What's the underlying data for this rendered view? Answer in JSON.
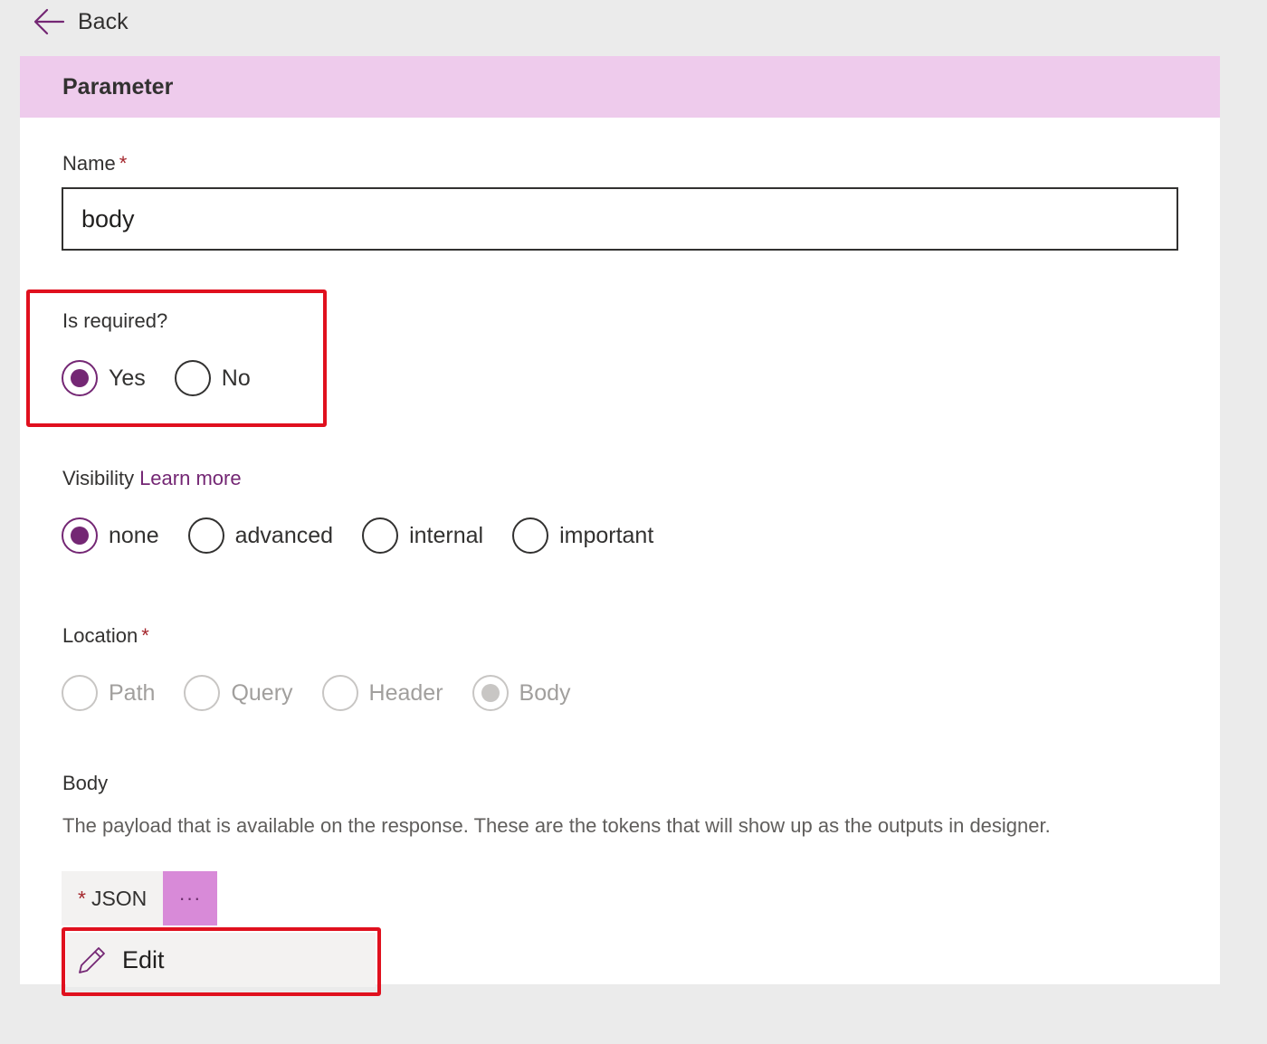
{
  "back": {
    "label": "Back"
  },
  "header": {
    "title": "Parameter"
  },
  "name": {
    "label": "Name",
    "required_mark": "*",
    "value": "body"
  },
  "is_required": {
    "label": "Is required?",
    "options": [
      {
        "label": "Yes",
        "checked": true
      },
      {
        "label": "No",
        "checked": false
      }
    ]
  },
  "visibility": {
    "label": "Visibility",
    "learn_more": "Learn more",
    "options": [
      {
        "label": "none",
        "checked": true
      },
      {
        "label": "advanced",
        "checked": false
      },
      {
        "label": "internal",
        "checked": false
      },
      {
        "label": "important",
        "checked": false
      }
    ]
  },
  "location": {
    "label": "Location",
    "required_mark": "*",
    "options": [
      {
        "label": "Path",
        "checked": false
      },
      {
        "label": "Query",
        "checked": false
      },
      {
        "label": "Header",
        "checked": false
      },
      {
        "label": "Body",
        "checked": true
      }
    ]
  },
  "body_section": {
    "label": "Body",
    "description": "The payload that is available on the response. These are the tokens that will show up as the outputs in designer."
  },
  "json": {
    "required_mark": "*",
    "label": "JSON",
    "more": "···"
  },
  "edit_menu": {
    "label": "Edit"
  },
  "colors": {
    "accent": "#742774",
    "header_bg": "#eecbec",
    "highlight": "#e0101e",
    "more_button": "#d88ad8"
  },
  "icons": {
    "back": "arrow-left-icon",
    "edit": "pencil-icon"
  }
}
